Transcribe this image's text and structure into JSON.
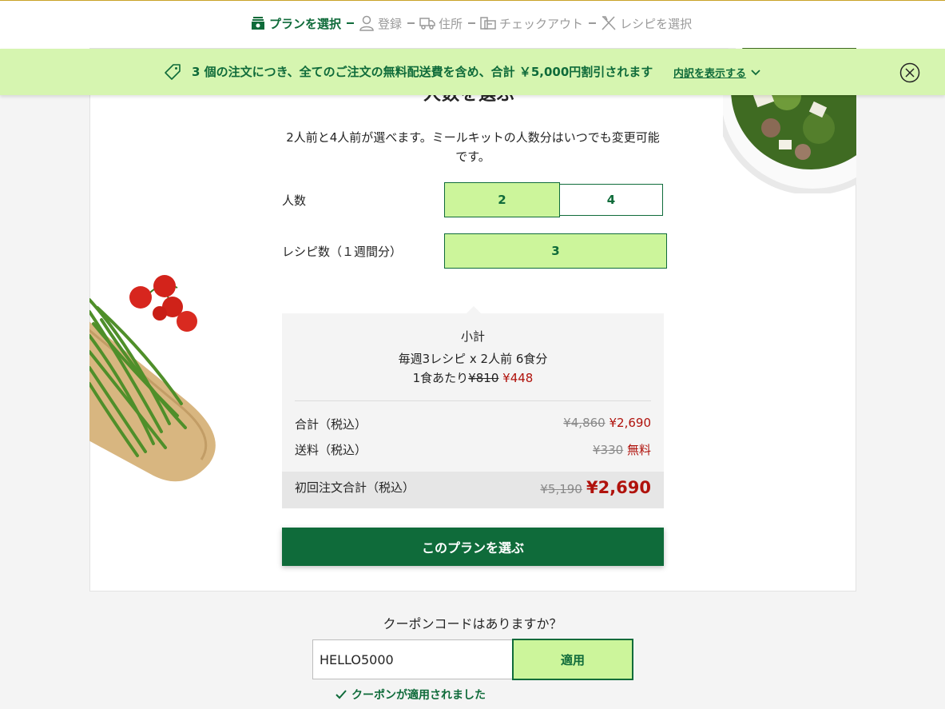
{
  "steps": [
    {
      "label": "プランを選択",
      "icon": "plan-box-icon",
      "active": true
    },
    {
      "label": "登録",
      "icon": "user-icon",
      "active": false
    },
    {
      "label": "住所",
      "icon": "truck-icon",
      "active": false
    },
    {
      "label": "チェックアウト",
      "icon": "wallet-icon",
      "active": false
    },
    {
      "label": "レシピを選択",
      "icon": "utensils-icon",
      "active": false
    }
  ],
  "promo": {
    "message": "3 個の注文につき、全てのご注文の無料配送費を含め、合計 ￥5,000円割引されます",
    "details_link": "内訳を表示する"
  },
  "plan": {
    "heading_peek": "人数を選ぶ",
    "description": "2人前と4人前が選べます。ミールキットの人数分はいつでも変更可能です。",
    "people_label": "人数",
    "people_options": [
      "2",
      "4"
    ],
    "people_selected": "2",
    "recipes_label": "レシピ数（１週間分）",
    "recipes_options": [
      "3"
    ],
    "recipes_selected": "3"
  },
  "summary": {
    "title": "小計",
    "line": "毎週3レシピ x 2人前 6食分",
    "per_meal_prefix": "1食あたり",
    "per_meal_old": "¥810",
    "per_meal_new": "¥448",
    "subtotal_label": "合計（税込）",
    "subtotal_old": "¥4,860",
    "subtotal_new": "¥2,690",
    "shipping_label": "送料（税込）",
    "shipping_old": "¥330",
    "shipping_new": "無料",
    "total_label": "初回注文合計（税込）",
    "total_old": "¥5,190",
    "total_new": "¥2,690"
  },
  "cta_label": "このプランを選ぶ",
  "coupon": {
    "question": "クーポンコードはありますか？",
    "value": "HELLO5000",
    "apply_label": "適用",
    "applied_message": "クーポンが適用されました"
  },
  "colors": {
    "brand_green": "#0f6b3a",
    "accent_lime": "#ccf59b",
    "promo_bg": "#d6f5b0",
    "price_red": "#b0120c"
  }
}
